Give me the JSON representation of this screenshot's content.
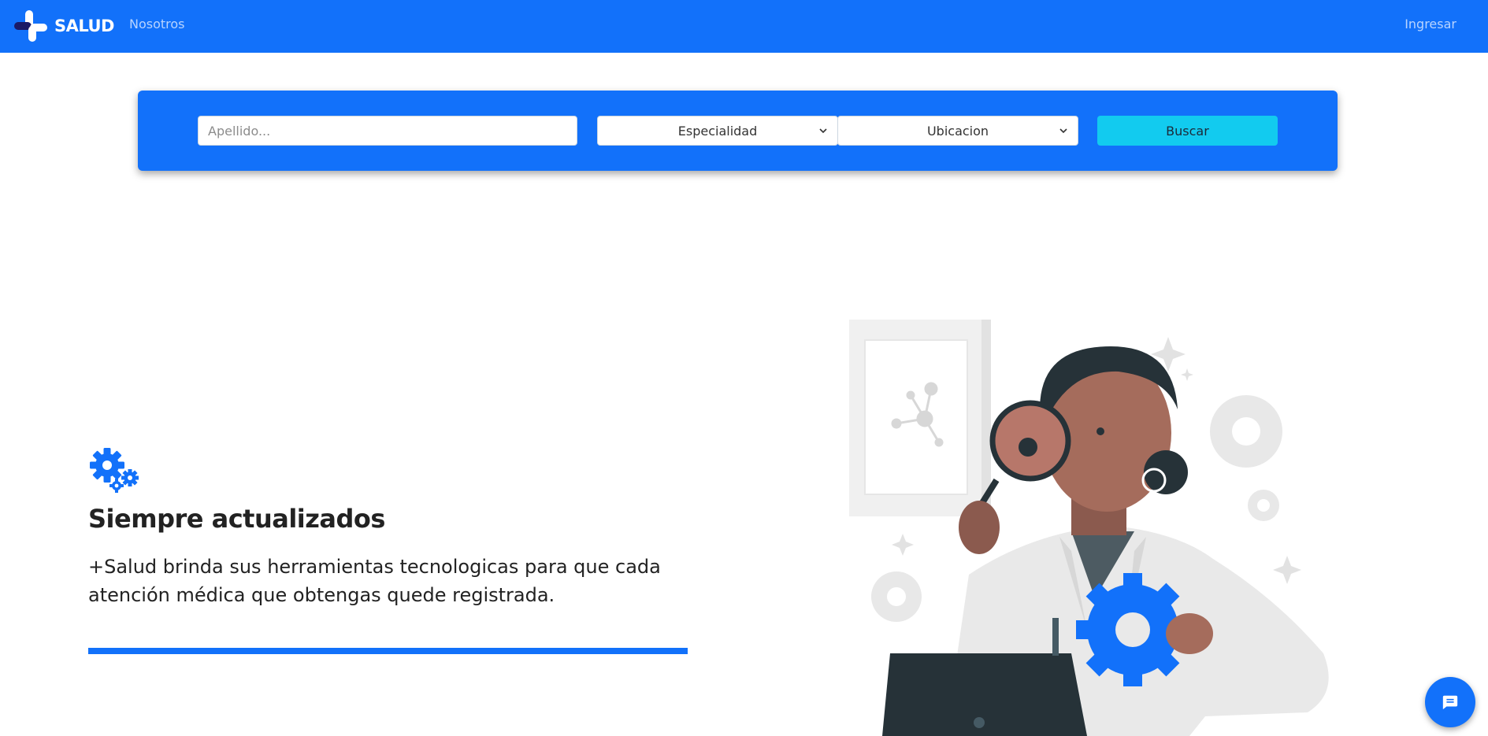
{
  "navbar": {
    "brand_text": "SALUD",
    "links": {
      "nosotros": "Nosotros",
      "ingresar": "Ingresar"
    }
  },
  "search": {
    "apellido_placeholder": "Apellido...",
    "apellido_value": "",
    "especialidad": "Especialidad",
    "ubicacion": "Ubicacion",
    "button": "Buscar"
  },
  "feature": {
    "icon": "gears-icon",
    "title": "Siempre actualizados",
    "text": "+Salud brinda sus herramientas tecnologicas para que cada atención médica que obtengas quede registrada."
  },
  "chat": {
    "icon": "chat-icon"
  },
  "colors": {
    "primary": "#1271fa",
    "accent": "#12cbef",
    "text": "#222222"
  }
}
